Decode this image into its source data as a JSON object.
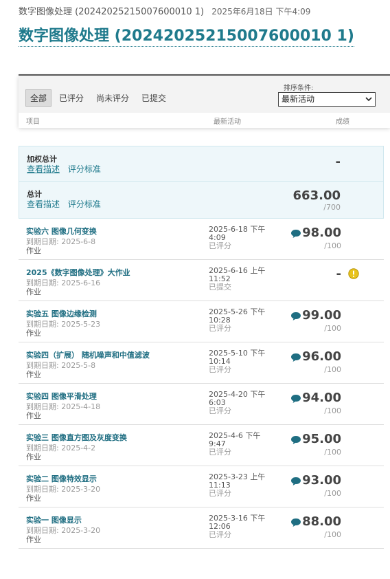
{
  "header": {
    "course_small": "数字图像处理 (20242025215007600010 1)",
    "date": "2025年6月18日 下午4:09",
    "title": "数字图像处理 (20242025215007600010 1)"
  },
  "filters": {
    "all": "全部",
    "graded": "已评分",
    "ungraded": "尚未评分",
    "submitted": "已提交"
  },
  "sort": {
    "label": "排序条件:",
    "selected": "最新活动"
  },
  "columns": {
    "item": "项目",
    "activity": "最新活动",
    "grade": "成绩"
  },
  "weighted_total": {
    "label": "加权总计",
    "link_desc": "查看描述",
    "link_rubric": "评分标准",
    "score": "-"
  },
  "total": {
    "label": "总计",
    "link_desc": "查看描述",
    "link_rubric": "评分标准",
    "score": "663.00",
    "denom": "/700"
  },
  "rows": [
    {
      "name": "实验六 图像几何变换",
      "due": "到期日期: 2025-6-8",
      "type": "作业",
      "act1": "2025-6-18 下午",
      "act2": "4:09",
      "status": "已评分",
      "score": "98.00",
      "denom": "/100"
    },
    {
      "name": "2025《数字图像处理》大作业",
      "due": "到期日期: 2025-6-16",
      "type": "作业",
      "act1": "2025-6-16 上午",
      "act2": "11:52",
      "status": "已提交",
      "score": "-",
      "denom": ""
    },
    {
      "name": "实验五 图像边缘检测",
      "due": "到期日期: 2025-5-23",
      "type": "作业",
      "act1": "2025-5-26 下午",
      "act2": "10:28",
      "status": "已评分",
      "score": "99.00",
      "denom": "/100"
    },
    {
      "name": "实验四（扩展） 随机噪声和中值滤波",
      "due": "到期日期: 2025-5-8",
      "type": "作业",
      "act1": "2025-5-10 下午",
      "act2": "10:14",
      "status": "已评分",
      "score": "96.00",
      "denom": "/100"
    },
    {
      "name": "实验四 图像平滑处理",
      "due": "到期日期: 2025-4-18",
      "type": "作业",
      "act1": "2025-4-20 下午",
      "act2": "6:03",
      "status": "已评分",
      "score": "94.00",
      "denom": "/100"
    },
    {
      "name": "实验三 图像直方图及灰度变换",
      "due": "到期日期: 2025-4-2",
      "type": "作业",
      "act1": "2025-4-6 下午",
      "act2": "9:47",
      "status": "已评分",
      "score": "95.00",
      "denom": "/100"
    },
    {
      "name": "实验二 图像特效显示",
      "due": "到期日期: 2025-3-20",
      "type": "作业",
      "act1": "2025-3-23 上午",
      "act2": "11:13",
      "status": "已评分",
      "score": "93.00",
      "denom": "/100"
    },
    {
      "name": "实验一 图像显示",
      "due": "到期日期: 2025-3-20",
      "type": "作业",
      "act1": "2025-3-16 下午",
      "act2": "12:06",
      "status": "已评分",
      "score": "88.00",
      "denom": "/100"
    }
  ],
  "colors": {
    "accent": "#1f7a8c",
    "link": "#1f6e82",
    "summary_bg": "#eef7fa",
    "alert": "#e8c31c"
  }
}
